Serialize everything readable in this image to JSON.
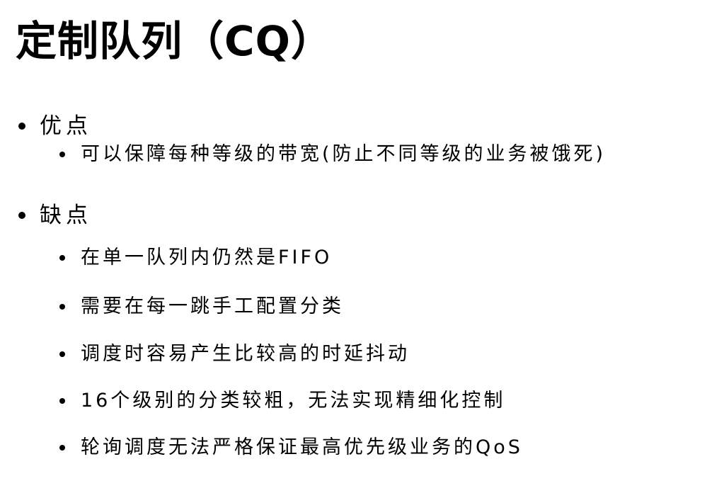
{
  "title": "定制队列（CQ）",
  "advantages": {
    "label": "优点",
    "items": [
      "可以保障每种等级的带宽(防止不同等级的业务被饿死)"
    ]
  },
  "disadvantages": {
    "label": "缺点",
    "items": [
      "在单一队列内仍然是FIFO",
      "需要在每一跳手工配置分类",
      "调度时容易产生比较高的时延抖动",
      "16个级别的分类较粗，无法实现精细化控制",
      "轮询调度无法严格保证最高优先级业务的QoS"
    ]
  }
}
